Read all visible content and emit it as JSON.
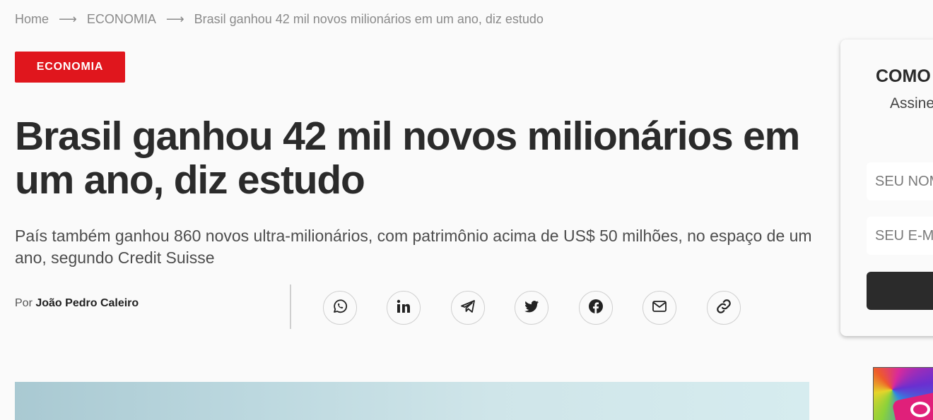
{
  "breadcrumb": {
    "home": "Home",
    "separator": "⟶",
    "section": "ECONOMIA",
    "current": "Brasil ganhou 42 mil novos milionários em um ano, diz estudo"
  },
  "category": {
    "label": "ECONOMIA",
    "color": "#e0161d"
  },
  "article": {
    "headline": "Brasil ganhou 42 mil novos milionários em um ano, diz estudo",
    "subtitle": "País também ganhou 860 novos ultra-milionários, com patrimônio acima de US$ 50 milhões, no espaço de um ano, segundo Credit Suisse",
    "byline_prefix": "Por",
    "author": "João Pedro Caleiro"
  },
  "share": {
    "buttons": [
      {
        "icon": "whatsapp-icon"
      },
      {
        "icon": "linkedin-icon"
      },
      {
        "icon": "telegram-icon"
      },
      {
        "icon": "twitter-icon"
      },
      {
        "icon": "facebook-icon"
      },
      {
        "icon": "email-icon"
      },
      {
        "icon": "link-icon"
      }
    ]
  },
  "newsletter": {
    "title": "COMO",
    "subtitle": "Assine",
    "name_placeholder": "SEU NOME",
    "email_placeholder": "SEU E-MAIL"
  }
}
